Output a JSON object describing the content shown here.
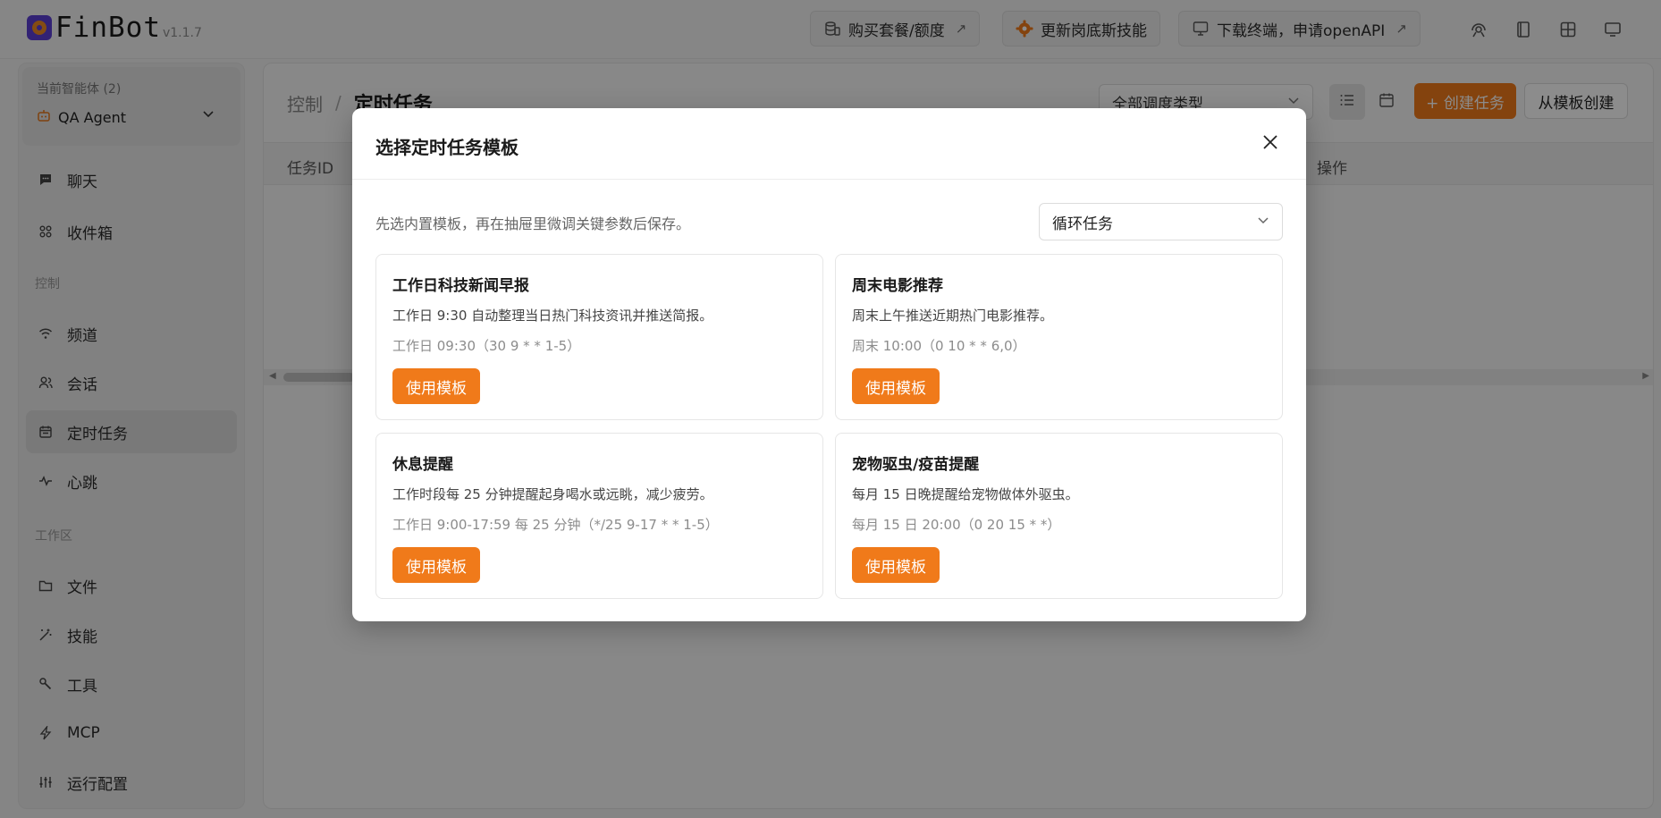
{
  "app": {
    "name": "FinBot",
    "version": "v1.1.7"
  },
  "topbar": {
    "buy_label": "购买套餐/额度",
    "update_label": "更新岗底斯技能",
    "download_label": "下载终端，申请openAPI",
    "external_arrow": "↗"
  },
  "sidebar": {
    "agent_caption": "当前智能体 (2)",
    "agent_name": "QA Agent",
    "items": [
      {
        "label": "聊天",
        "icon": "chat-icon"
      },
      {
        "label": "收件箱",
        "icon": "inbox-icon"
      },
      {
        "label": "频道",
        "icon": "wifi-icon"
      },
      {
        "label": "会话",
        "icon": "users-icon"
      },
      {
        "label": "定时任务",
        "icon": "calendar-icon"
      },
      {
        "label": "心跳",
        "icon": "pulse-icon"
      },
      {
        "label": "文件",
        "icon": "folder-icon"
      },
      {
        "label": "技能",
        "icon": "magic-icon"
      },
      {
        "label": "工具",
        "icon": "wrench-icon"
      },
      {
        "label": "MCP",
        "icon": "bolt-icon"
      },
      {
        "label": "运行配置",
        "icon": "sliders-icon"
      }
    ],
    "sections": {
      "control": "控制",
      "workspace": "工作区"
    }
  },
  "main": {
    "breadcrumb_parent": "控制",
    "breadcrumb_sep": "/",
    "breadcrumb_current": "定时任务",
    "filter_value": "全部调度类型",
    "create_label": "+ 创建任务",
    "from_template_label": "从模板创建",
    "columns": [
      "任务ID",
      "操作"
    ]
  },
  "modal": {
    "title": "选择定时任务模板",
    "hint": "先选内置模板，再在抽屉里微调关键参数后保存。",
    "type_value": "循环任务",
    "use_label": "使用模板",
    "templates": [
      {
        "title": "工作日科技新闻早报",
        "desc": "工作日 9:30 自动整理当日热门科技资讯并推送简报。",
        "schedule": "工作日 09:30（30 9 * * 1-5）"
      },
      {
        "title": "周末电影推荐",
        "desc": "周末上午推送近期热门电影推荐。",
        "schedule": "周末 10:00（0 10 * * 6,0）"
      },
      {
        "title": "休息提醒",
        "desc": "工作时段每 25 分钟提醒起身喝水或远眺，减少疲劳。",
        "schedule": "工作日 9:00-17:59 每 25 分钟（*/25 9-17 * * 1-5）"
      },
      {
        "title": "宠物驱虫/疫苗提醒",
        "desc": "每月 15 日晚提醒给宠物做体外驱虫。",
        "schedule": "每月 15 日 20:00（0 20 15 * *）"
      }
    ]
  },
  "colors": {
    "accent": "#f07a1a",
    "brand": "#5b3fd4"
  }
}
